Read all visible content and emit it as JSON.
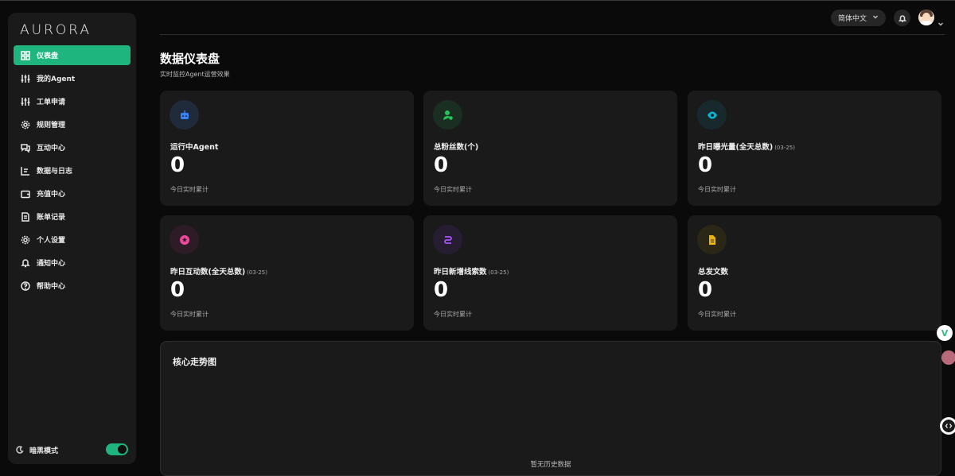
{
  "app": {
    "logo": "AURORA"
  },
  "sidebar": {
    "items": [
      {
        "label": "仪表盘",
        "icon": "dashboard-icon",
        "active": true
      },
      {
        "label": "我的Agent",
        "icon": "sliders-icon"
      },
      {
        "label": "工单申请",
        "icon": "sliders-icon"
      },
      {
        "label": "规则管理",
        "icon": "gear-icon"
      },
      {
        "label": "互动中心",
        "icon": "chat-icon"
      },
      {
        "label": "数据与日志",
        "icon": "chart-icon"
      },
      {
        "label": "充值中心",
        "icon": "wallet-icon"
      },
      {
        "label": "账单记录",
        "icon": "document-icon"
      },
      {
        "label": "个人设置",
        "icon": "gear-icon"
      },
      {
        "label": "通知中心",
        "icon": "bell-icon"
      },
      {
        "label": "帮助中心",
        "icon": "help-icon"
      }
    ],
    "dark_mode_label": "暗黑模式",
    "dark_mode_on": true
  },
  "header": {
    "language": "简体中文"
  },
  "page": {
    "title": "数据仪表盘",
    "subtitle": "实时监控Agent运营效果"
  },
  "cards": [
    {
      "label": "运行中Agent",
      "date": "",
      "value": "0",
      "footer": "今日实时累计",
      "icon": "robot-icon",
      "color": "#3b82f6"
    },
    {
      "label": "总粉丝数(个)",
      "date": "",
      "value": "0",
      "footer": "今日实时累计",
      "icon": "user-icon",
      "color": "#22c55e"
    },
    {
      "label": "昨日曝光量(全天总数)",
      "date": "(03-25)",
      "value": "0",
      "footer": "今日实时累计",
      "icon": "eye-icon",
      "color": "#06b6d4"
    },
    {
      "label": "昨日互动数(全天总数)",
      "date": "(03-25)",
      "value": "0",
      "footer": "今日实时累计",
      "icon": "star-chat-icon",
      "color": "#ec4899"
    },
    {
      "label": "昨日新增线索数",
      "date": "(03-25)",
      "value": "0",
      "footer": "今日实时累计",
      "icon": "route-icon",
      "color": "#a855f7"
    },
    {
      "label": "总发文数",
      "date": "",
      "value": "0",
      "footer": "今日实时累计",
      "icon": "file-icon",
      "color": "#eab308"
    }
  ],
  "trend": {
    "title": "核心走势图",
    "empty": "暂无历史数据"
  },
  "colors": {
    "accent": "#1fb57e",
    "background": "#0a0a0a",
    "card": "#1a1a1a"
  }
}
